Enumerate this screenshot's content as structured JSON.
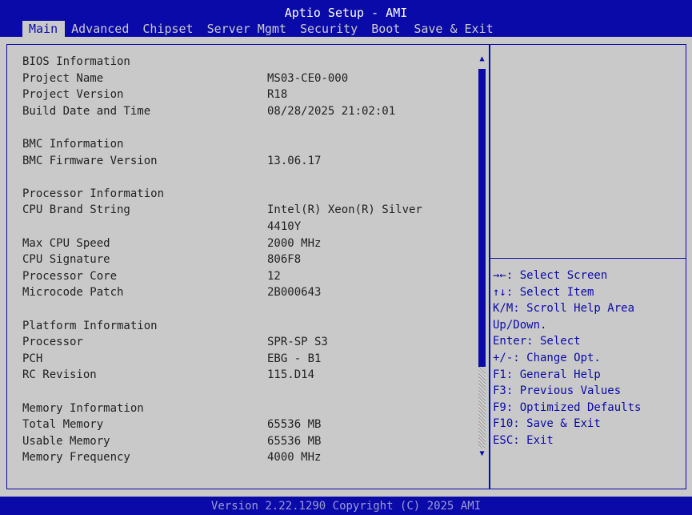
{
  "header": {
    "title": "Aptio Setup - AMI"
  },
  "menu": {
    "items": [
      "Main",
      "Advanced",
      "Chipset",
      "Server Mgmt",
      "Security",
      "Boot",
      "Save & Exit"
    ],
    "active_index": 0
  },
  "main": {
    "rows": [
      {
        "label": "BIOS Information",
        "value": ""
      },
      {
        "label": "Project Name",
        "value": "MS03-CE0-000"
      },
      {
        "label": "Project Version",
        "value": "R18"
      },
      {
        "label": "Build Date and Time",
        "value": "08/28/2025 21:02:01"
      },
      {
        "label": "BMC Information",
        "value": ""
      },
      {
        "label": "BMC Firmware Version",
        "value": "13.06.17"
      },
      {
        "label": "Processor Information",
        "value": ""
      },
      {
        "label": "CPU Brand String",
        "value": "Intel(R) Xeon(R) Silver"
      },
      {
        "label": "",
        "value": "4410Y"
      },
      {
        "label": "Max CPU Speed",
        "value": "2000 MHz"
      },
      {
        "label": "CPU Signature",
        "value": "806F8"
      },
      {
        "label": "Processor Core",
        "value": "12"
      },
      {
        "label": "Microcode Patch",
        "value": "2B000643"
      },
      {
        "label": "Platform Information",
        "value": ""
      },
      {
        "label": "Processor",
        "value": "SPR-SP S3"
      },
      {
        "label": "PCH",
        "value": "EBG - B1"
      },
      {
        "label": "RC Revision",
        "value": "115.D14"
      },
      {
        "label": "Memory Information",
        "value": ""
      },
      {
        "label": "Total Memory",
        "value": "65536 MB"
      },
      {
        "label": "Usable Memory",
        "value": "65536 MB"
      },
      {
        "label": "Memory Frequency",
        "value": "4000 MHz"
      }
    ]
  },
  "help": {
    "lines": [
      "→←: Select Screen",
      "↑↓: Select Item",
      "K/M: Scroll Help Area",
      "Up/Down.",
      "Enter: Select",
      "+/-: Change Opt.",
      "F1: General Help",
      "F3: Previous Values",
      "F9: Optimized Defaults",
      "F10: Save & Exit",
      "ESC: Exit"
    ]
  },
  "footer": {
    "version": "Version 2.22.1290 Copyright (C) 2025 AMI"
  },
  "colors": {
    "bios_blue": "#0a0aa8",
    "background": "#c9c9c9",
    "text": "#222222"
  }
}
